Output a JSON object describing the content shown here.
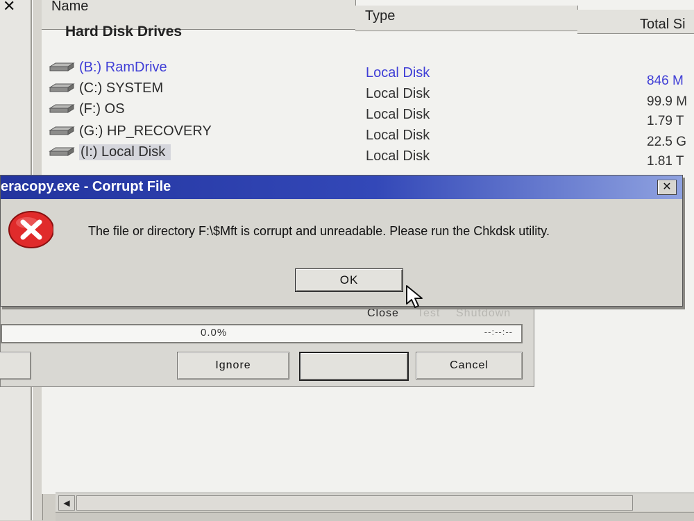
{
  "left_pane": {
    "close_glyph": "✕"
  },
  "explorer": {
    "columns": {
      "name": "Name",
      "type": "Type",
      "total_size": "Total Si"
    },
    "group_title": "Hard Disk Drives",
    "drives": [
      {
        "name": "(B:) RamDrive",
        "type": "Local Disk",
        "size": "846 M",
        "icon": "drive-icon"
      },
      {
        "name": "(C:) SYSTEM",
        "type": "Local Disk",
        "size": "99.9 M",
        "icon": "drive-icon"
      },
      {
        "name": "(F:) OS",
        "type": "Local Disk",
        "size": "1.79 T",
        "icon": "drive-icon"
      },
      {
        "name": "(G:) HP_RECOVERY",
        "type": "Local Disk",
        "size": "22.5 G",
        "icon": "drive-icon"
      },
      {
        "name": "(I:) Local Disk",
        "type": "Local Disk",
        "size": "1.81 T",
        "icon": "drive-icon"
      }
    ]
  },
  "teracopy": {
    "options": {
      "close": "Close",
      "test": "Test",
      "shutdown": "Shutdown"
    },
    "progress_text": "0.0%",
    "progress_value": 0.0,
    "time_remaining": "--:--:--",
    "buttons": {
      "ignore": "Ignore",
      "blank": "",
      "cancel": "Cancel"
    }
  },
  "dialog": {
    "title": "eracopy.exe - Corrupt File",
    "close_glyph": "✕",
    "message": "The file or directory F:\\$Mft is corrupt and unreadable. Please run the Chkdsk utility.",
    "ok_label": "OK",
    "icon": "error-icon"
  },
  "scrollbar": {
    "left_arrow": "◀"
  },
  "colors": {
    "title_gradient_start": "#23349e",
    "title_gradient_end": "#8fa2e0",
    "active_text": "#3f3ed6",
    "error_red": "#e02b2b"
  }
}
